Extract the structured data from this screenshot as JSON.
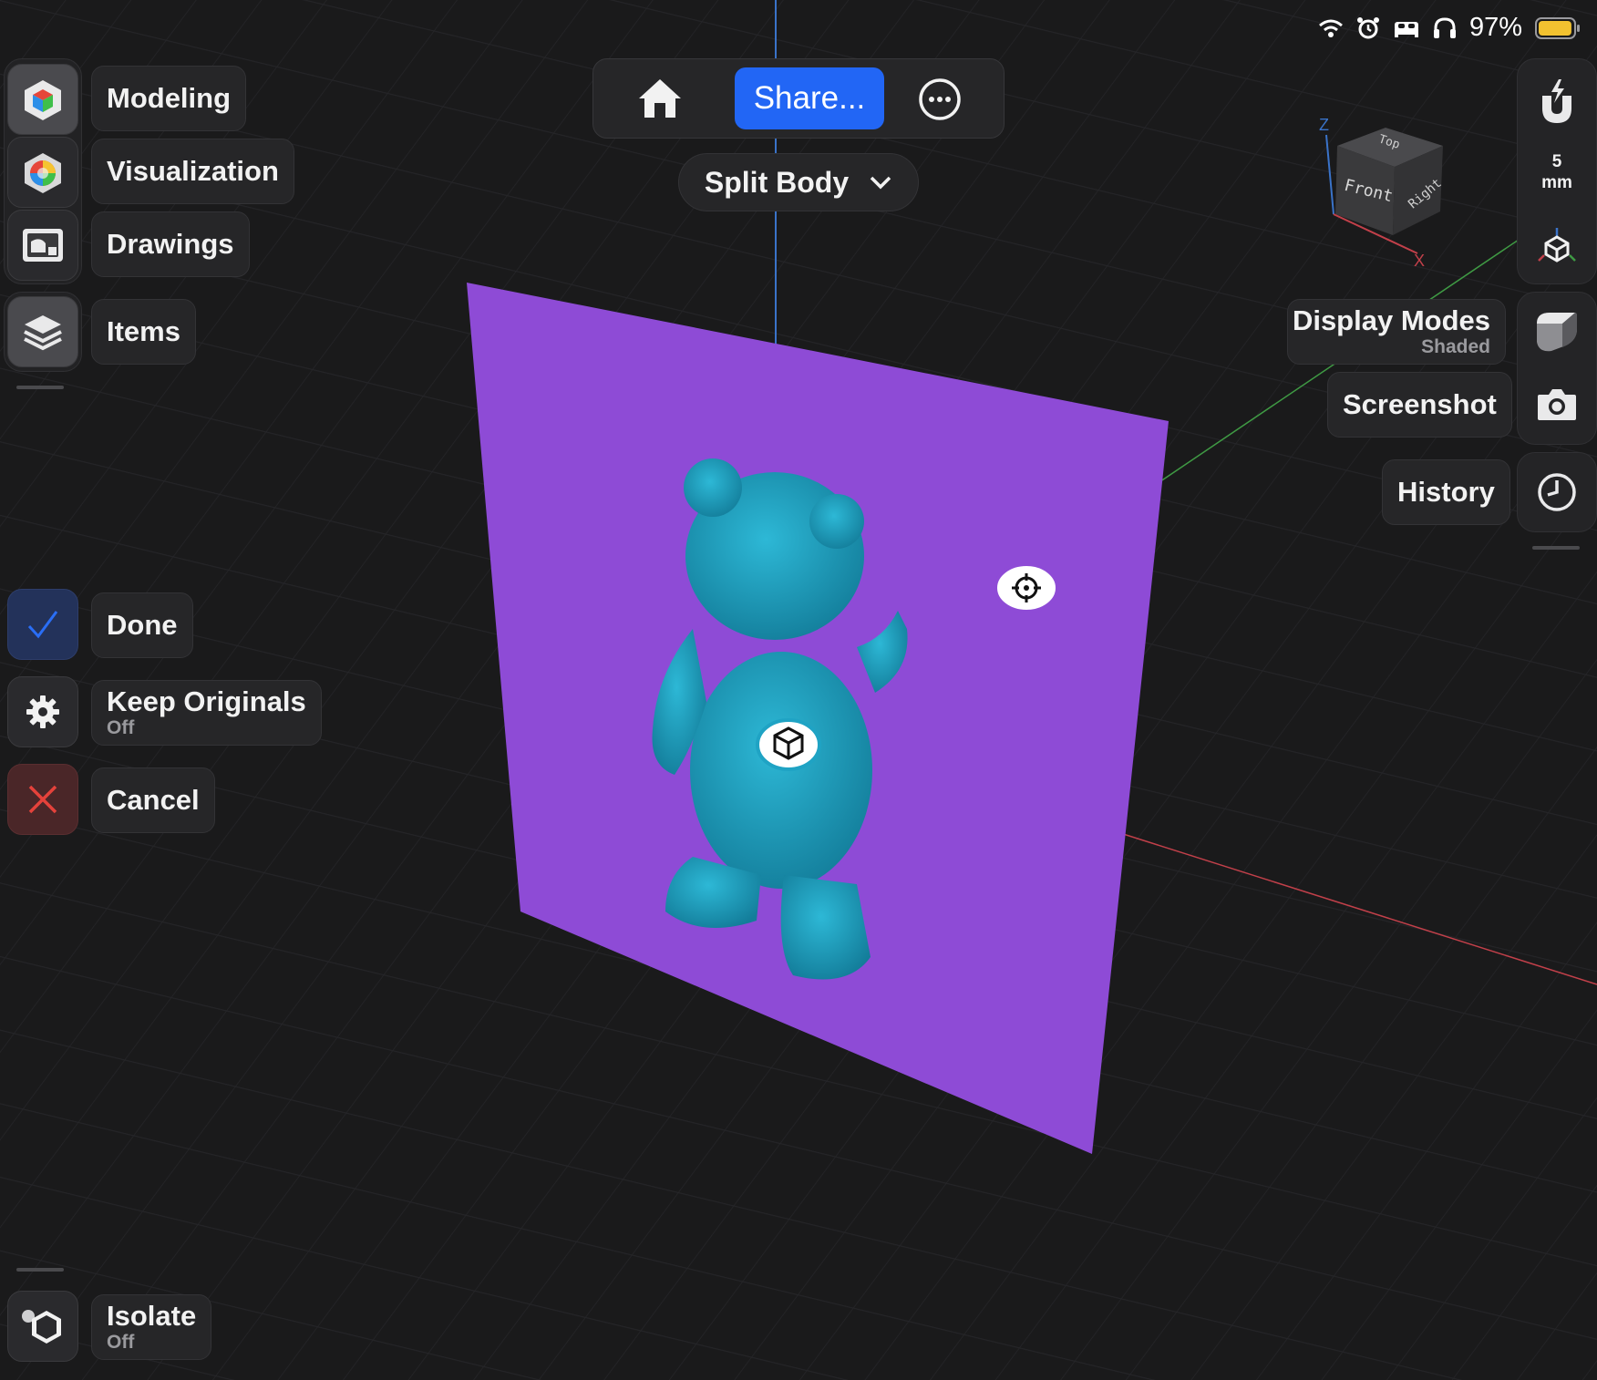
{
  "status_bar": {
    "battery_percent": "97%",
    "battery_level": 0.97,
    "icons": [
      "wifi-icon",
      "alarm-icon",
      "sleep-bed-icon",
      "headphones-icon",
      "battery-icon"
    ]
  },
  "toolbar": {
    "share_label": "Share...",
    "home_icon": "home-icon",
    "more_icon": "more-ellipsis-icon"
  },
  "tool_selector": {
    "label": "Split Body"
  },
  "workspaces": [
    {
      "label": "Modeling",
      "icon": "modeling-cube-icon",
      "active": true
    },
    {
      "label": "Visualization",
      "icon": "color-wheel-icon",
      "active": false
    },
    {
      "label": "Drawings",
      "icon": "drawings-icon",
      "active": false
    }
  ],
  "items": {
    "label": "Items",
    "icon": "layers-icon"
  },
  "actions": {
    "done_label": "Done",
    "keep_originals_label": "Keep Originals",
    "keep_originals_value": "Off",
    "cancel_label": "Cancel"
  },
  "isolate": {
    "label": "Isolate",
    "value": "Off"
  },
  "right_panel": {
    "snap_value": "5",
    "snap_unit": "mm",
    "display_modes_label": "Display Modes",
    "display_modes_value": "Shaded",
    "screenshot_label": "Screenshot",
    "history_label": "History"
  },
  "view_cube": {
    "faces": {
      "top": "Top",
      "front": "Front",
      "right": "Right"
    },
    "axes": {
      "z": "Z",
      "x": "X"
    }
  },
  "colors": {
    "accent_blue": "#2266f5",
    "split_plane": "#8e4bd6",
    "model": "#1fa3c4",
    "axis_x": "#c2404a",
    "axis_y": "#3f9a44",
    "axis_z": "#3a73c9",
    "cancel_red": "#e5423b"
  }
}
